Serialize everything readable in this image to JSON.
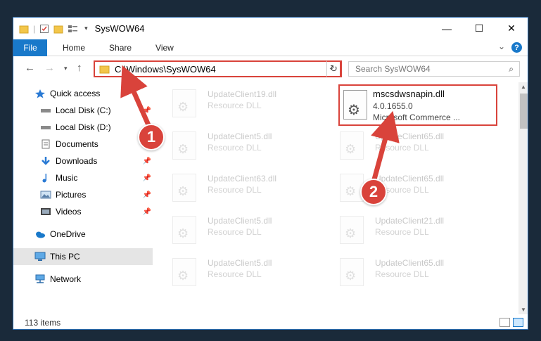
{
  "window": {
    "title": "SysWOW64",
    "controls": {
      "minimize": "—",
      "maximize": "☐",
      "close": "✕"
    }
  },
  "ribbon": {
    "tabs": [
      "File",
      "Home",
      "Share",
      "View"
    ],
    "help": "?"
  },
  "address": {
    "path": "C:\\Windows\\SysWOW64",
    "search_placeholder": "Search SysWOW64"
  },
  "sidebar": {
    "items": [
      {
        "label": "Quick access",
        "icon": "star-icon",
        "pinned": false
      },
      {
        "label": "Local Disk (C:)",
        "icon": "drive-icon",
        "pinned": true
      },
      {
        "label": "Local Disk (D:)",
        "icon": "drive-icon",
        "pinned": false
      },
      {
        "label": "Documents",
        "icon": "documents-icon",
        "pinned": true
      },
      {
        "label": "Downloads",
        "icon": "downloads-icon",
        "pinned": true
      },
      {
        "label": "Music",
        "icon": "music-icon",
        "pinned": true
      },
      {
        "label": "Pictures",
        "icon": "pictures-icon",
        "pinned": true
      },
      {
        "label": "Videos",
        "icon": "videos-icon",
        "pinned": true
      },
      {
        "label": "OneDrive",
        "icon": "onedrive-icon",
        "pinned": false
      },
      {
        "label": "This PC",
        "icon": "pc-icon",
        "pinned": false
      },
      {
        "label": "Network",
        "icon": "network-icon",
        "pinned": false
      }
    ]
  },
  "files": {
    "highlighted": {
      "name": "mscsdwsnapin.dll",
      "version": "4.0.1655.0",
      "company": "Microsoft Commerce ..."
    },
    "faded": [
      {
        "name": "UpdateClient19.dll",
        "desc": "Resource DLL"
      },
      {
        "name": "UpdateClient5.dll",
        "desc": "Resource DLL"
      },
      {
        "name": "UpdateClient65.dll",
        "desc": "Resource DLL"
      },
      {
        "name": "UpdateClient63.dll",
        "desc": "Resource DLL"
      },
      {
        "name": "UpdateClient65.dll",
        "desc": "Resource DLL"
      },
      {
        "name": "UpdateClient5.dll",
        "desc": "Resource DLL"
      },
      {
        "name": "UpdateClient21.dll",
        "desc": "Resource DLL"
      },
      {
        "name": "UpdateClient5.dll",
        "desc": "Resource DLL"
      },
      {
        "name": "UpdateClient65.dll",
        "desc": "Resource DLL"
      }
    ]
  },
  "status": {
    "item_count": "113 items"
  },
  "annotations": {
    "step1": "1",
    "step2": "2"
  },
  "colors": {
    "accent": "#1979ca",
    "highlight": "#d9433b"
  }
}
